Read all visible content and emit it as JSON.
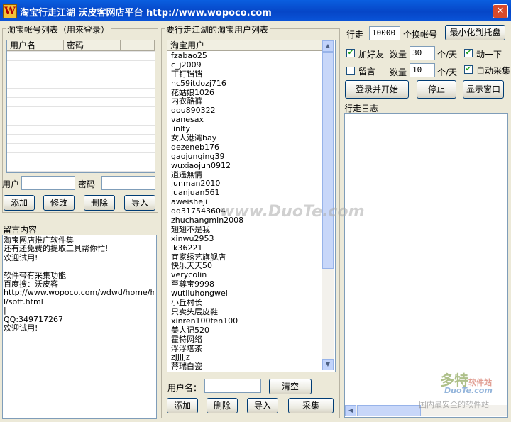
{
  "window": {
    "title": "淘宝行走江湖 沃皮客网店平台 http://www.wopoco.com",
    "close_glyph": "✕",
    "icon_letter": "W"
  },
  "accounts": {
    "group_title": "淘宝帐号列表（用来登录）",
    "col_user": "用户名",
    "col_pass": "密码",
    "user_label": "用户",
    "pass_label": "密码",
    "user_value": "",
    "pass_value": "",
    "add": "添加",
    "edit": "修改",
    "delete": "删除",
    "import": "导入"
  },
  "message": {
    "group_title": "留言内容",
    "lines": [
      "淘宝网店推广软件集",
      "还有还免费的提取工具帮你忙!",
      "欢迎试用!",
      "",
      "软件带有采集功能",
      "百度搜：沃皮客",
      "http://www.wopoco.com/wdwd/home/htm",
      "l/soft.html",
      "|",
      "QQ:349717267",
      "欢迎试用!"
    ]
  },
  "targets": {
    "group_title": "要行走江湖的淘宝用户列表",
    "col_user": "淘宝用户",
    "users": [
      "fzabao25",
      "c_j2009",
      "丁钉铛铛",
      "nc59itdozj716",
      "花姑娘1026",
      "内衣酷裤",
      "dou890322",
      "vanesax",
      "linlty",
      "女人港湾bay",
      "dezeneb176",
      "gaojunqing39",
      "wuxiaojun0912",
      "逍遥無情",
      "junman2010",
      "juanjuan561",
      "aweisheji",
      "qq317543604",
      "zhuchangmin2008",
      "翅翅不是我",
      "xinwu2953",
      "lk36221",
      "宜家绣艺旗舰店",
      "快乐天天50",
      "verycolin",
      "至尊宝9998",
      "wutliuhongwei",
      "小丘村长",
      "只卖头层皮鞋",
      "xinren100fen100",
      "美人记520",
      "霍特网络",
      "浮浮塔茶",
      "zjjjjjz",
      "蒂瑞白瓷"
    ],
    "username_label": "用户名：",
    "username_value": "",
    "clear": "清空",
    "add": "添加",
    "delete": "删除",
    "import": "导入",
    "collect": "采集"
  },
  "settings": {
    "walk_label": "行走",
    "walk_value": "10000",
    "switch_label": "个换帐号",
    "minimize": "最小化到托盘",
    "add_friend_label": "加好友",
    "add_friend_checked": true,
    "qty_label_1": "数量",
    "qty_value_1": "30",
    "per_day_1": "个/天",
    "act_label": "动一下",
    "act_checked": true,
    "msg_label": "留言",
    "msg_checked": false,
    "qty_label_2": "数量",
    "qty_value_2": "10",
    "per_day_2": "个/天",
    "auto_collect_label": "自动采集",
    "auto_collect_checked": true,
    "check_glyph": "✔",
    "login_start": "登录并开始",
    "stop": "停止",
    "show_window": "显示窗口",
    "log_title": "行走日志"
  },
  "watermark": {
    "text": "www.DuoTe.com",
    "logo_main": "多特",
    "logo_sub": "软件站",
    "logo_url": "DuoTe.com",
    "logo_slogan": "国内最安全的软件站"
  },
  "scroll_glyphs": {
    "up": "▲",
    "down": "▼",
    "left": "◀",
    "right": "▶"
  }
}
